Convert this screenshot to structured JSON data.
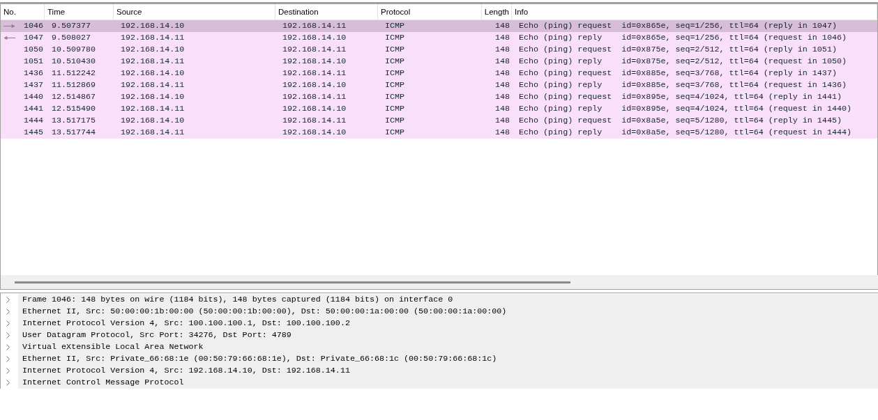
{
  "packet_list": {
    "columns": [
      "No.",
      "Time",
      "Source",
      "Destination",
      "Protocol",
      "Length",
      "Info"
    ],
    "rows": [
      {
        "kind": "request",
        "selected": true,
        "cells": [
          "1046",
          "9.507377",
          "192.168.14.10",
          "192.168.14.11",
          "ICMP",
          "148",
          "Echo (ping) request  id=0x865e, seq=1/256, ttl=64 (reply in 1047)"
        ]
      },
      {
        "kind": "reply",
        "selected": false,
        "cells": [
          "1047",
          "9.508027",
          "192.168.14.11",
          "192.168.14.10",
          "ICMP",
          "148",
          "Echo (ping) reply    id=0x865e, seq=1/256, ttl=64 (request in 1046)"
        ]
      },
      {
        "kind": "plain",
        "selected": false,
        "cells": [
          "1050",
          "10.509780",
          "192.168.14.10",
          "192.168.14.11",
          "ICMP",
          "148",
          "Echo (ping) request  id=0x875e, seq=2/512, ttl=64 (reply in 1051)"
        ]
      },
      {
        "kind": "plain",
        "selected": false,
        "cells": [
          "1051",
          "10.510430",
          "192.168.14.11",
          "192.168.14.10",
          "ICMP",
          "148",
          "Echo (ping) reply    id=0x875e, seq=2/512, ttl=64 (request in 1050)"
        ]
      },
      {
        "kind": "plain",
        "selected": false,
        "cells": [
          "1436",
          "11.512242",
          "192.168.14.10",
          "192.168.14.11",
          "ICMP",
          "148",
          "Echo (ping) request  id=0x885e, seq=3/768, ttl=64 (reply in 1437)"
        ]
      },
      {
        "kind": "plain",
        "selected": false,
        "cells": [
          "1437",
          "11.512869",
          "192.168.14.11",
          "192.168.14.10",
          "ICMP",
          "148",
          "Echo (ping) reply    id=0x885e, seq=3/768, ttl=64 (request in 1436)"
        ]
      },
      {
        "kind": "plain",
        "selected": false,
        "cells": [
          "1440",
          "12.514867",
          "192.168.14.10",
          "192.168.14.11",
          "ICMP",
          "148",
          "Echo (ping) request  id=0x895e, seq=4/1024, ttl=64 (reply in 1441)"
        ]
      },
      {
        "kind": "plain",
        "selected": false,
        "cells": [
          "1441",
          "12.515490",
          "192.168.14.11",
          "192.168.14.10",
          "ICMP",
          "148",
          "Echo (ping) reply    id=0x895e, seq=4/1024, ttl=64 (request in 1440)"
        ]
      },
      {
        "kind": "plain",
        "selected": false,
        "cells": [
          "1444",
          "13.517175",
          "192.168.14.10",
          "192.168.14.11",
          "ICMP",
          "148",
          "Echo (ping) request  id=0x8a5e, seq=5/1280, ttl=64 (reply in 1445)"
        ]
      },
      {
        "kind": "plain",
        "selected": false,
        "cells": [
          "1445",
          "13.517744",
          "192.168.14.11",
          "192.168.14.10",
          "ICMP",
          "148",
          "Echo (ping) reply    id=0x8a5e, seq=5/1280, ttl=64 (request in 1444)"
        ]
      }
    ]
  },
  "packet_details": [
    {
      "label": "Frame 1046: 148 bytes on wire (1184 bits), 148 bytes captured (1184 bits) on interface 0",
      "expanded": false
    },
    {
      "label": "Ethernet II, Src: 50:00:00:1b:00:00 (50:00:00:1b:00:00), Dst: 50:00:00:1a:00:00 (50:00:00:1a:00:00)",
      "expanded": false
    },
    {
      "label": "Internet Protocol Version 4, Src: 100.100.100.1, Dst: 100.100.100.2",
      "expanded": false
    },
    {
      "label": "User Datagram Protocol, Src Port: 34276, Dst Port: 4789",
      "expanded": false
    },
    {
      "label": "Virtual eXtensible Local Area Network",
      "expanded": false
    },
    {
      "label": "Ethernet II, Src: Private_66:68:1e (00:50:79:66:68:1e), Dst: Private_66:68:1c (00:50:79:66:68:1c)",
      "expanded": false
    },
    {
      "label": "Internet Protocol Version 4, Src: 192.168.14.10, Dst: 192.168.14.11",
      "expanded": false
    },
    {
      "label": "Internet Control Message Protocol",
      "expanded": false
    }
  ]
}
